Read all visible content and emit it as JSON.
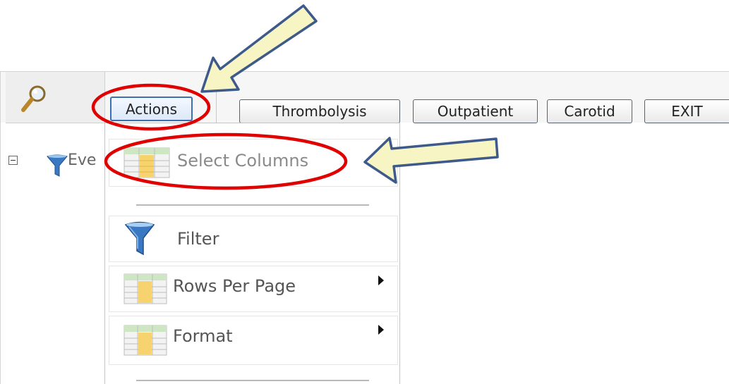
{
  "toolbar": {
    "actions_label": "Actions",
    "buttons": [
      {
        "label": "Thrombolysis"
      },
      {
        "label": "Outpatient"
      },
      {
        "label": "Carotid"
      },
      {
        "label": "EXIT"
      }
    ]
  },
  "menu": {
    "select_columns": "Select Columns",
    "filter": "Filter",
    "rows_per_page": "Rows Per Page",
    "format": "Format"
  },
  "tree": {
    "item_label": "Eve"
  },
  "colors": {
    "annotation_red": "#e00000",
    "arrow_fill": "#f7f5c4",
    "arrow_stroke": "#3d5a8a",
    "filter_blue": "#3a78c2"
  }
}
